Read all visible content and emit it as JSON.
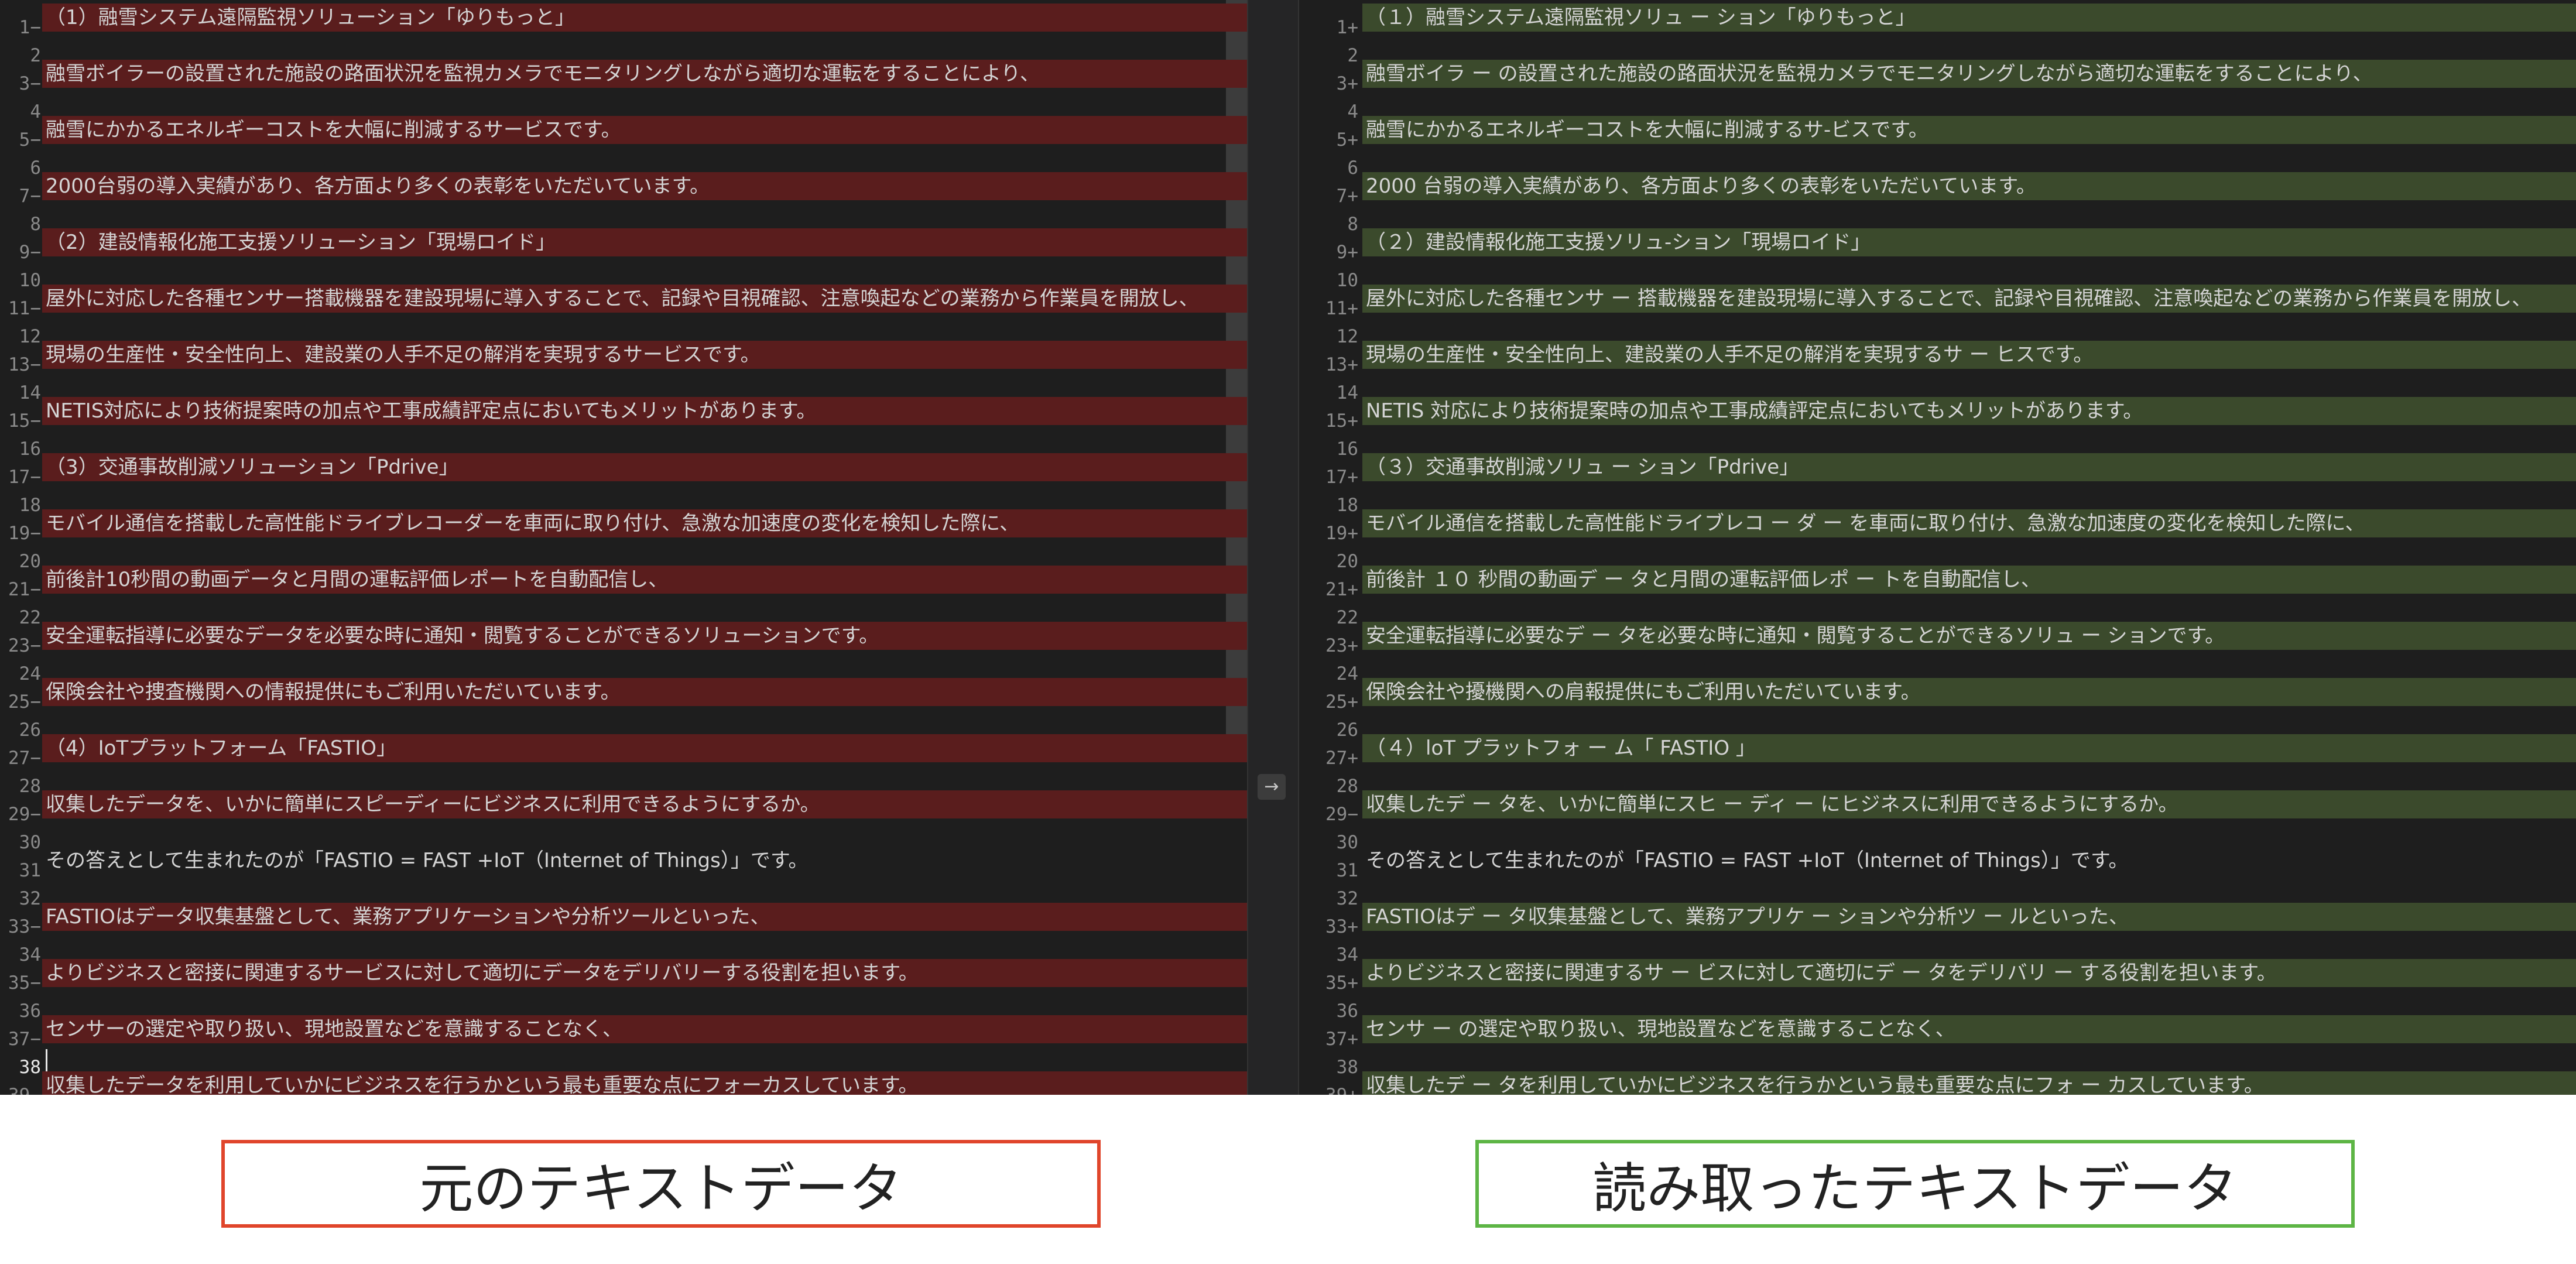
{
  "left_pane": {
    "lines": [
      {
        "n": "1",
        "m": "−",
        "t": "（1）融雪システム遠隔監視ソリューション「ゆりもっと」",
        "hl": true
      },
      {
        "n": "2",
        "m": "",
        "t": "",
        "hl": false
      },
      {
        "n": "3",
        "m": "−",
        "t": "融雪ボイラーの設置された施設の路面状況を監視カメラでモニタリングしながら適切な運転をすることにより、",
        "hl": true
      },
      {
        "n": "4",
        "m": "",
        "t": "",
        "hl": false
      },
      {
        "n": "5",
        "m": "−",
        "t": "融雪にかかるエネルギーコストを大幅に削減するサービスです。",
        "hl": true
      },
      {
        "n": "6",
        "m": "",
        "t": "",
        "hl": false
      },
      {
        "n": "7",
        "m": "−",
        "t": "2000台弱の導入実績があり、各方面より多くの表彰をいただいています。",
        "hl": true
      },
      {
        "n": "8",
        "m": "",
        "t": "",
        "hl": false
      },
      {
        "n": "9",
        "m": "−",
        "t": "（2）建設情報化施工支援ソリューション「現場ロイド」",
        "hl": true
      },
      {
        "n": "10",
        "m": "",
        "t": "",
        "hl": false
      },
      {
        "n": "11",
        "m": "−",
        "t": "屋外に対応した各種センサー搭載機器を建設現場に導入することで、記録や目視確認、注意喚起などの業務から作業員を開放し、",
        "hl": true
      },
      {
        "n": "12",
        "m": "",
        "t": "",
        "hl": false
      },
      {
        "n": "13",
        "m": "−",
        "t": "現場の生産性・安全性向上、建設業の人手不足の解消を実現するサービスです。",
        "hl": true
      },
      {
        "n": "14",
        "m": "",
        "t": "",
        "hl": false
      },
      {
        "n": "15",
        "m": "−",
        "t": "NETIS対応により技術提案時の加点や工事成績評定点においてもメリットがあります。",
        "hl": true
      },
      {
        "n": "16",
        "m": "",
        "t": "",
        "hl": false
      },
      {
        "n": "17",
        "m": "−",
        "t": "（3）交通事故削減ソリューション「Pdrive」",
        "hl": true
      },
      {
        "n": "18",
        "m": "",
        "t": "",
        "hl": false
      },
      {
        "n": "19",
        "m": "−",
        "t": "モバイル通信を搭載した高性能ドライブレコーダーを車両に取り付け、急激な加速度の変化を検知した際に、",
        "hl": true
      },
      {
        "n": "20",
        "m": "",
        "t": "",
        "hl": false
      },
      {
        "n": "21",
        "m": "−",
        "t": "前後計10秒間の動画データと月間の運転評価レポートを自動配信し、",
        "hl": true
      },
      {
        "n": "22",
        "m": "",
        "t": "",
        "hl": false
      },
      {
        "n": "23",
        "m": "−",
        "t": "安全運転指導に必要なデータを必要な時に通知・閲覧することができるソリューションです。",
        "hl": true
      },
      {
        "n": "24",
        "m": "",
        "t": "",
        "hl": false
      },
      {
        "n": "25",
        "m": "−",
        "t": "保険会社や捜査機関への情報提供にもご利用いただいています。",
        "hl": true
      },
      {
        "n": "26",
        "m": "",
        "t": "",
        "hl": false
      },
      {
        "n": "27",
        "m": "−",
        "t": "（4）IoTプラットフォーム「FASTIO」",
        "hl": true
      },
      {
        "n": "28",
        "m": "",
        "t": "",
        "hl": false
      },
      {
        "n": "29",
        "m": "−",
        "t": "収集したデータを、いかに簡単にスピーディーにビジネスに利用できるようにするか。",
        "hl": true
      },
      {
        "n": "30",
        "m": "",
        "t": "",
        "hl": false
      },
      {
        "n": "31",
        "m": "",
        "t": "その答えとして生まれたのが「FASTIO = FAST +IoT（Internet of Things）」です。",
        "hl": false
      },
      {
        "n": "32",
        "m": "",
        "t": "",
        "hl": false
      },
      {
        "n": "33",
        "m": "−",
        "t": "FASTIOはデータ収集基盤として、業務アプリケーションや分析ツールといった、",
        "hl": true
      },
      {
        "n": "34",
        "m": "",
        "t": "",
        "hl": false
      },
      {
        "n": "35",
        "m": "−",
        "t": "よりビジネスと密接に関連するサービスに対して適切にデータをデリバリーする役割を担います。",
        "hl": true
      },
      {
        "n": "36",
        "m": "",
        "t": "",
        "hl": false
      },
      {
        "n": "37",
        "m": "−",
        "t": "センサーの選定や取り扱い、現地設置などを意識することなく、",
        "hl": true
      },
      {
        "n": "38",
        "m": "",
        "t": "",
        "hl": false
      },
      {
        "n": "39",
        "m": "−",
        "t": "収集したデータを利用していかにビジネスを行うかという最も重要な点にフォーカスしています。",
        "hl": true
      }
    ]
  },
  "right_pane": {
    "lines": [
      {
        "n": "1",
        "m": "+",
        "t": "（１）融雪システム遠隔監視ソリュ ー ション「ゆりもっと」",
        "hl": true
      },
      {
        "n": "2",
        "m": "",
        "t": "",
        "hl": false
      },
      {
        "n": "3",
        "m": "+",
        "t": "融雪ボイラ ー の設置された施設の路面状況を監視カメラでモニタリングしながら適切な運転をすることにより、",
        "hl": true
      },
      {
        "n": "4",
        "m": "",
        "t": "",
        "hl": false
      },
      {
        "n": "5",
        "m": "+",
        "t": "融雪にかかるエネルギーコストを大幅に削減するサ-ビスです。",
        "hl": true
      },
      {
        "n": "6",
        "m": "",
        "t": "",
        "hl": false
      },
      {
        "n": "7",
        "m": "+",
        "t": "2000 台弱の導入実績があり、各方面より多くの表彰をいただいています。",
        "hl": true
      },
      {
        "n": "8",
        "m": "",
        "t": "",
        "hl": false
      },
      {
        "n": "9",
        "m": "+",
        "t": "（２）建設情報化施工支援ソリュ-ション「現場ロイド」",
        "hl": true
      },
      {
        "n": "10",
        "m": "",
        "t": "",
        "hl": false
      },
      {
        "n": "11",
        "m": "+",
        "t": "屋外に対応した各種センサ ー 搭載機器を建設現場に導入することで、記録や目視確認、注意喚起などの業務から作業員を開放し、",
        "hl": true
      },
      {
        "n": "12",
        "m": "",
        "t": "",
        "hl": false
      },
      {
        "n": "13",
        "m": "+",
        "t": "現場の生産性・安全性向上、建設業の人手不足の解消を実現するサ ー ヒスです。",
        "hl": true
      },
      {
        "n": "14",
        "m": "",
        "t": "",
        "hl": false
      },
      {
        "n": "15",
        "m": "+",
        "t": "NETIS 対応により技術提案時の加点や工事成績評定点においてもメリットがあります。",
        "hl": true
      },
      {
        "n": "16",
        "m": "",
        "t": "",
        "hl": false
      },
      {
        "n": "17",
        "m": "+",
        "t": "（３）交通事故削減ソリュ ー ション「Pdrive」",
        "hl": true
      },
      {
        "n": "18",
        "m": "",
        "t": "",
        "hl": false
      },
      {
        "n": "19",
        "m": "+",
        "t": "モバイル通信を搭載した高性能ドライブレコ ー ダ ー を車両に取り付け、急激な加速度の変化を検知した際に、",
        "hl": true
      },
      {
        "n": "20",
        "m": "",
        "t": "",
        "hl": false
      },
      {
        "n": "21",
        "m": "+",
        "t": "前後計 １０ 秒間の動画デ ー タと月間の運転評価レポ ー トを自動配信し、",
        "hl": true
      },
      {
        "n": "22",
        "m": "",
        "t": "",
        "hl": false
      },
      {
        "n": "23",
        "m": "+",
        "t": "安全運転指導に必要なデ ー タを必要な時に通知・閲覧することができるソリュ ー ションです。",
        "hl": true
      },
      {
        "n": "24",
        "m": "",
        "t": "",
        "hl": false
      },
      {
        "n": "25",
        "m": "+",
        "t": "保険会社や擾機関への肩報提供にもご利用いただいています。",
        "hl": true
      },
      {
        "n": "26",
        "m": "",
        "t": "",
        "hl": false
      },
      {
        "n": "27",
        "m": "+",
        "t": "（４）loT プラットフォ ー ム「 FASTIO 」",
        "hl": true
      },
      {
        "n": "28",
        "m": "",
        "t": "",
        "hl": false
      },
      {
        "n": "29",
        "m": "−",
        "t": "収集したデ ー タを、いかに簡単にスヒ ー ディ ー にヒジネスに利用できるようにするか。",
        "hl": true
      },
      {
        "n": "30",
        "m": "",
        "t": "",
        "hl": false
      },
      {
        "n": "31",
        "m": "",
        "t": "その答えとして生まれたのが「FASTIO = FAST +IoT（Internet of Things）」です。",
        "hl": false
      },
      {
        "n": "32",
        "m": "",
        "t": "",
        "hl": false
      },
      {
        "n": "33",
        "m": "+",
        "t": "FASTIOはデ ー タ収集基盤として、業務アプリケ ー ションや分析ツ ー ルといった、",
        "hl": true
      },
      {
        "n": "34",
        "m": "",
        "t": "",
        "hl": false
      },
      {
        "n": "35",
        "m": "+",
        "t": "よりビジネスと密接に関連するサ ー ビスに対して適切にデ ー タをデリバリ ー する役割を担います。",
        "hl": true
      },
      {
        "n": "36",
        "m": "",
        "t": "",
        "hl": false
      },
      {
        "n": "37",
        "m": "+",
        "t": "センサ ー の選定や取り扱い、現地設置などを意識することなく、",
        "hl": true
      },
      {
        "n": "38",
        "m": "",
        "t": "",
        "hl": false
      },
      {
        "n": "39",
        "m": "+",
        "t": "収集したデ ー タを利用していかにビジネスを行うかという最も重要な点にフォ ー カスしています。",
        "hl": true
      }
    ]
  },
  "divider_arrow": "→",
  "captions": {
    "left": "元のテキストデータ",
    "right": "読み取ったテキストデータ"
  },
  "colors": {
    "editor_bg": "#1e1e1e",
    "removed_line_bg": "#5a1d1d",
    "added_line_bg": "#3b4a2c",
    "left_caption_border": "#e0452b",
    "right_caption_border": "#5db545"
  },
  "cursor_line": "38"
}
